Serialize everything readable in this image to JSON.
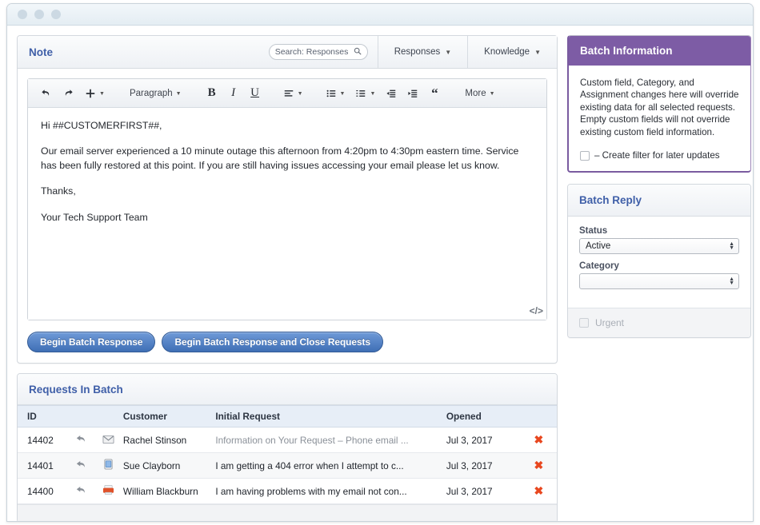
{
  "window": {
    "buttons": [
      "close",
      "minimize",
      "zoom"
    ]
  },
  "note_panel": {
    "title": "Note",
    "search": {
      "placeholder": "Search: Responses",
      "value": "",
      "icon": "search-icon"
    },
    "header_buttons": [
      {
        "label": "Responses",
        "caret": "▼"
      },
      {
        "label": "Knowledge",
        "caret": "▼"
      }
    ]
  },
  "editor": {
    "toolbar": [
      {
        "name": "undo",
        "glyph": "↶",
        "caret": ""
      },
      {
        "name": "redo",
        "glyph": "↷",
        "caret": ""
      },
      {
        "name": "insert",
        "glyph": "✚",
        "caret": "▼"
      },
      {
        "name": "paragraph-style",
        "label": "Paragraph",
        "caret": "▼"
      },
      {
        "name": "bold",
        "glyph": "B",
        "caret": ""
      },
      {
        "name": "italic",
        "glyph": "I",
        "caret": ""
      },
      {
        "name": "underline",
        "glyph": "U",
        "caret": ""
      },
      {
        "name": "align",
        "glyph": "align",
        "caret": "▼"
      },
      {
        "name": "bulleted-list",
        "glyph": "ul",
        "caret": "▼"
      },
      {
        "name": "numbered-list",
        "glyph": "ol",
        "caret": "▼"
      },
      {
        "name": "outdent",
        "glyph": "outdent",
        "caret": ""
      },
      {
        "name": "indent",
        "glyph": "indent",
        "caret": ""
      },
      {
        "name": "blockquote",
        "glyph": "“",
        "caret": ""
      },
      {
        "name": "more",
        "label": "More",
        "caret": "▼"
      }
    ],
    "body": {
      "greeting": "Hi ##CUSTOMERFIRST##,",
      "paragraph": "Our email server experienced a 10 minute outage this afternoon from 4:20pm to 4:30pm eastern time. Service has been fully restored at this point. If you are still having issues accessing your email please let us know.",
      "closing": "Thanks,",
      "signature": "Your Tech Support Team"
    },
    "code_handle": "</>"
  },
  "actions": {
    "begin_batch_response": "Begin Batch Response",
    "begin_batch_response_close": "Begin Batch Response and Close Requests"
  },
  "requests_panel": {
    "title": "Requests In Batch",
    "columns": {
      "id": "ID",
      "flag": "",
      "channel": "",
      "customer": "Customer",
      "initial_request": "Initial Request",
      "opened": "Opened",
      "delete": ""
    },
    "rows": [
      {
        "id": "14402",
        "flag_icon": "reply-arrow-icon",
        "channel_icon": "envelope-icon",
        "customer": "Rachel Stinson",
        "initial_request": "Information on Your Request – Phone email ...",
        "request_muted": true,
        "opened": "Jul 3, 2017",
        "delete_icon": "✖"
      },
      {
        "id": "14401",
        "flag_icon": "reply-arrow-icon",
        "channel_icon": "mobile-phone-icon",
        "customer": "Sue Clayborn",
        "initial_request": "I am getting a 404 error when I attempt to c...",
        "request_muted": false,
        "opened": "Jul 3, 2017",
        "delete_icon": "✖"
      },
      {
        "id": "14400",
        "flag_icon": "reply-arrow-icon",
        "channel_icon": "fax-icon",
        "customer": "William Blackburn",
        "initial_request": "I am having problems with my email not con...",
        "request_muted": false,
        "opened": "Jul 3, 2017",
        "delete_icon": "✖"
      }
    ]
  },
  "batch_information": {
    "title": "Batch Information",
    "description": "Custom field, Category, and Assignment changes here will override existing data for all selected requests. Empty custom fields will not override existing custom field information.",
    "checkbox_label": "– Create filter for later updates",
    "checkbox_checked": false
  },
  "batch_reply": {
    "title": "Batch Reply",
    "status_label": "Status",
    "status_value": "Active",
    "status_options": [
      "Active"
    ],
    "category_label": "Category",
    "category_value": "",
    "urgent_label": "Urgent",
    "urgent_checked": false,
    "urgent_disabled": true
  },
  "colors": {
    "accent_purple": "#7d5ca5",
    "link_blue": "#3f5fa8",
    "button_blue": "#3f6fb5",
    "delete_red": "#e8471f",
    "table_header_blue": "#e7eef7"
  }
}
